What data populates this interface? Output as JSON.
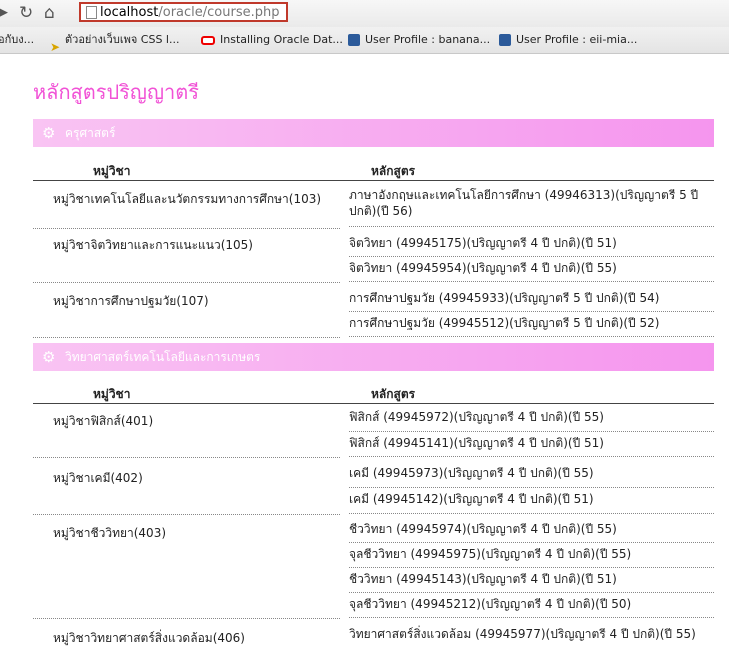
{
  "browser": {
    "url_host": "localhost",
    "url_path": "/oracle/course.php",
    "bookmarks": [
      {
        "label": "อกับง...",
        "icon": "bookmark-icon"
      },
      {
        "label": "ตัวอย่างเว็บเพจ CSS l...",
        "icon": "pin-icon"
      },
      {
        "label": "Installing Oracle Dat...",
        "icon": "oracle-icon"
      },
      {
        "label": "User Profile : banana...",
        "icon": "database-icon"
      },
      {
        "label": "User Profile : eii-mia...",
        "icon": "database-icon"
      }
    ]
  },
  "page": {
    "title": "หลักสูตรปริญญาตรี",
    "column_group": "หมู่วิชา",
    "column_course": "หลักสูตร"
  },
  "sections": [
    {
      "title": "ครุศาสตร์",
      "groups": [
        {
          "label": "หมู่วิชาเทคโนโลยีและนวัตกรรมทางการศึกษา(103)",
          "courses": [
            "ภาษาอังกฤษและเทคโนโลยีการศึกษา (49946313)(ปริญญาตรี 5 ปี ปกติ)(ปี 56)"
          ]
        },
        {
          "label": "หมู่วิชาจิตวิทยาและการแนะแนว(105)",
          "courses": [
            "จิตวิทยา (49945175)(ปริญญาตรี 4 ปี ปกติ)(ปี 51)",
            "จิตวิทยา (49945954)(ปริญญาตรี 4 ปี ปกติ)(ปี 55)"
          ]
        },
        {
          "label": "หมู่วิชาการศึกษาปฐมวัย(107)",
          "courses": [
            "การศึกษาปฐมวัย (49945933)(ปริญญาตรี 5 ปี ปกติ)(ปี 54)",
            "การศึกษาปฐมวัย (49945512)(ปริญญาตรี 5 ปี ปกติ)(ปี 52)"
          ]
        }
      ]
    },
    {
      "title": "วิทยาศาสตร์เทคโนโลยีและการเกษตร",
      "groups": [
        {
          "label": "หมู่วิชาฟิสิกส์(401)",
          "courses": [
            "ฟิสิกส์ (49945972)(ปริญญาตรี 4 ปี ปกติ)(ปี 55)",
            "ฟิสิกส์ (49945141)(ปริญญาตรี 4 ปี ปกติ)(ปี 51)"
          ]
        },
        {
          "label": "หมู่วิชาเคมี(402)",
          "courses": [
            "เคมี (49945973)(ปริญญาตรี 4 ปี ปกติ)(ปี 55)",
            "เคมี (49945142)(ปริญญาตรี 4 ปี ปกติ)(ปี 51)"
          ]
        },
        {
          "label": "หมู่วิชาชีววิทยา(403)",
          "courses": [
            "ชีววิทยา (49945974)(ปริญญาตรี 4 ปี ปกติ)(ปี 55)",
            "จุลชีววิทยา (49945975)(ปริญญาตรี 4 ปี ปกติ)(ปี 55)",
            "ชีววิทยา (49945143)(ปริญญาตรี 4 ปี ปกติ)(ปี 51)",
            "จุลชีววิทยา (49945212)(ปริญญาตรี 4 ปี ปกติ)(ปี 50)"
          ]
        },
        {
          "label": "หมู่วิชาวิทยาศาสตร์สิ่งแวดล้อม(406)",
          "courses": [
            "วิทยาศาสตร์สิ่งแวดล้อม (49945977)(ปริญญาตรี 4 ปี ปกติ)(ปี 55)"
          ]
        }
      ]
    }
  ]
}
